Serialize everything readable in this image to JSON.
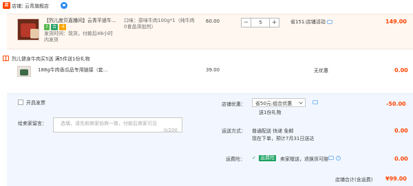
{
  "shop": {
    "label": "店铺：",
    "name": "云青旗舰店"
  },
  "item1": {
    "title_line1": "【烈儿度贝直播间】云青平遥牛...",
    "title_line2": "肉发货",
    "sku": "口味：原味牛肉100g*1（纯牛肉0食品添加剂）",
    "sku_line1": "口味：原味牛肉100g*1（纯牛肉",
    "sku_line2": "0食品添加剂）",
    "badge_7": "7",
    "badge_safe": "合",
    "badge_card": "卡",
    "ship_line1": "发货时间：现货，付款后48小时",
    "ship_line2": "内发货",
    "price": "60.00",
    "qty": "5",
    "qty_minus": "−",
    "qty_plus": "+",
    "promo": "省151:店铺活动",
    "subtotal": "149.00"
  },
  "gift": {
    "text": "烈儿健身牛肉买5送  满5件送1份礼物"
  },
  "item2": {
    "title": "188g牛肉香瓜品专用链接（套...",
    "price": "39.00",
    "promo": "无优惠",
    "subtotal": "0.00"
  },
  "invoice": {
    "label": "开具发票"
  },
  "message": {
    "label": "给卖家留言：",
    "placeholder_line1": "选填，请先和商家协商一致，付款后商家可见",
    "counter": "0/200"
  },
  "shop_discount": {
    "label": "店铺优惠：",
    "selected": "省50元:组合优惠",
    "sub": "送1份礼物",
    "amount": "-50.00"
  },
  "shipping": {
    "label": "运送方式：",
    "line1": "普通配送 快递 免邮",
    "line2": "现在下单，预计7月31日送达",
    "amount": "0.00"
  },
  "insurance": {
    "label": "运费险：",
    "tag": "运费险",
    "text": "卖家赠送，退换货可赔",
    "amount": "0.00"
  },
  "total": {
    "label": "店铺合计(含运费)",
    "value": "¥99.00"
  }
}
